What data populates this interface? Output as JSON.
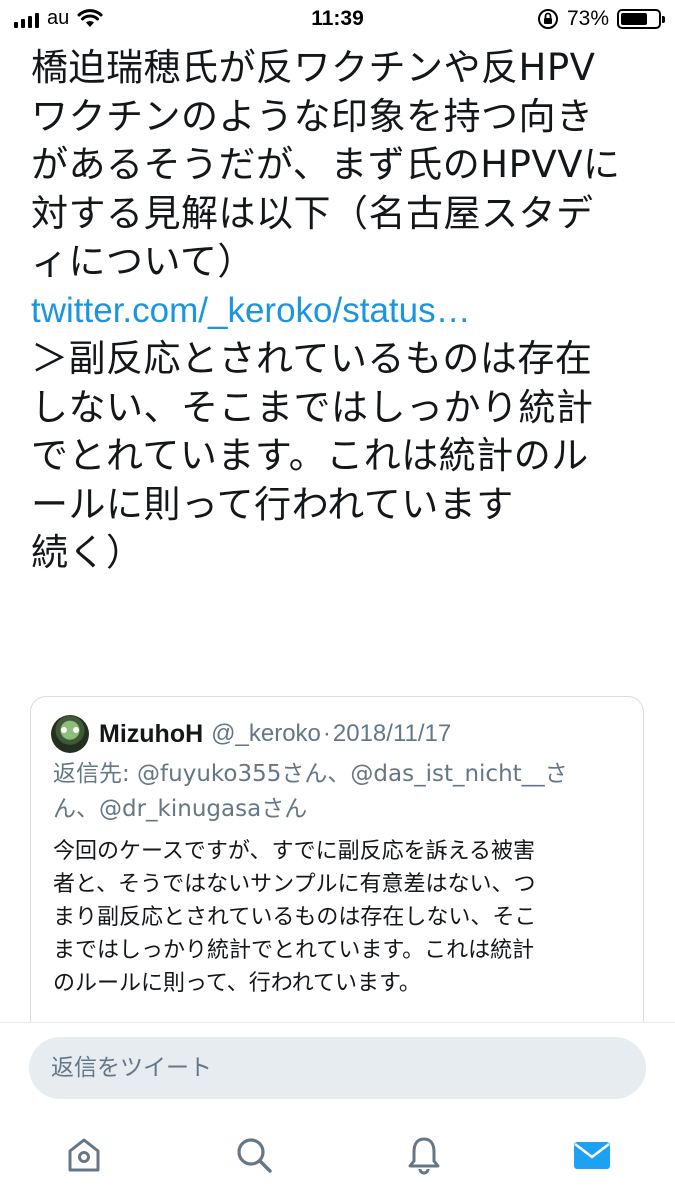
{
  "status_bar": {
    "carrier": "au",
    "time": "11:39",
    "battery_percent_label": "73%",
    "battery_level": 0.73
  },
  "tweet": {
    "body_lines": [
      "橋迫瑞穂氏が反ワクチンや反HPV",
      "ワクチンのような印象を持つ向き",
      "があるそうだが、まず氏のHPVVに",
      "対する見解は以下（名古屋スタデ",
      "ィについて）"
    ],
    "link_text": "twitter.com/_keroko/status…",
    "body_lines_2": [
      "＞副反応とされているものは存在",
      "しない、そこまではしっかり統計",
      "でとれています。これは統計のル",
      "ールに則って行われています",
      "続く）"
    ]
  },
  "quoted_tweet": {
    "name": "MizuhoH",
    "handle": "@_keroko",
    "separator": "·",
    "date": "2018/11/17",
    "replying_lines": [
      "返信先: @fuyuko355さん、@das_ist_nicht__さ",
      "ん、@dr_kinugasaさん"
    ],
    "text_lines": [
      "今回のケースですが、すでに副反応を訴える被害",
      "者と、そうではないサンプルに有意差はない、つ",
      "まり副反応とされているものは存在しない、そこ",
      "まではしっかり統計でとれています。これは統計",
      "のルールに則って、行われています。"
    ]
  },
  "reply": {
    "placeholder": "返信をツイート"
  },
  "tab_bar": {
    "tabs": [
      "home-icon",
      "search-icon",
      "notifications-icon",
      "messages-icon"
    ],
    "active_tab": "messages-icon"
  },
  "colors": {
    "link": "#1b95e0",
    "text": "#14171a",
    "secondary": "#657786",
    "active_tab": "#1da1f2",
    "inactive_tab": "#657786"
  }
}
